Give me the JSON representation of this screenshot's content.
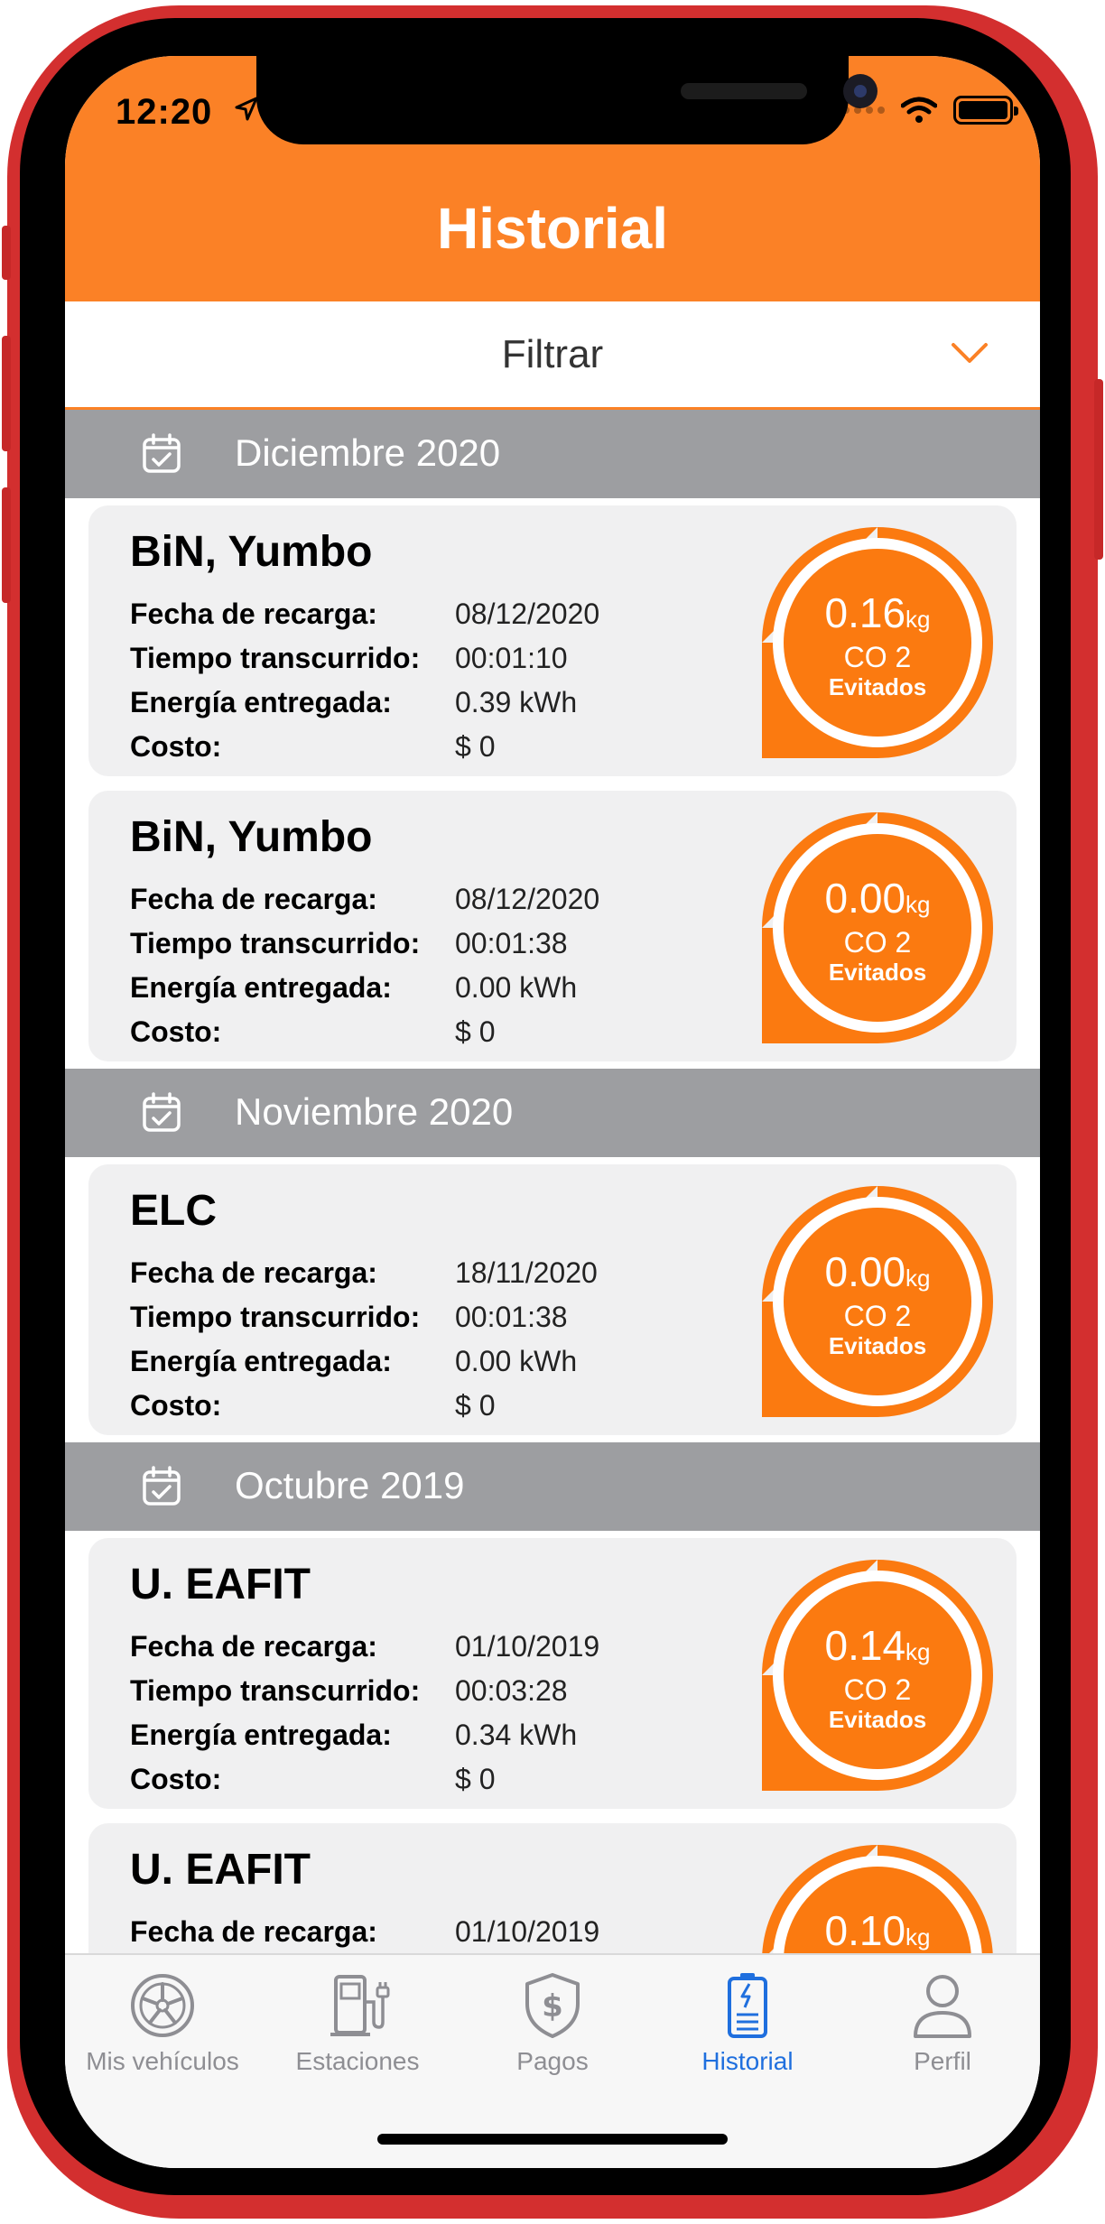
{
  "status_bar": {
    "time": "12:20"
  },
  "header": {
    "title": "Historial"
  },
  "filter": {
    "label": "Filtrar"
  },
  "labels": {
    "fecha": "Fecha de recarga:",
    "tiempo": "Tiempo transcurrido:",
    "energia": "Energía entregada:",
    "costo": "Costo:",
    "kg": "kg",
    "co2": "CO 2",
    "evitados": "Evitados"
  },
  "sections": [
    {
      "label": "Diciembre 2020"
    },
    {
      "label": "Noviembre 2020"
    },
    {
      "label": "Octubre 2019"
    }
  ],
  "cards": [
    {
      "station": "BiN, Yumbo",
      "date": "08/12/2020",
      "elapsed": "00:01:10",
      "energy": "0.39 kWh",
      "cost": "$ 0",
      "co2": "0.16"
    },
    {
      "station": "BiN, Yumbo",
      "date": "08/12/2020",
      "elapsed": "00:01:38",
      "energy": "0.00 kWh",
      "cost": "$ 0",
      "co2": "0.00"
    },
    {
      "station": "ELC",
      "date": "18/11/2020",
      "elapsed": "00:01:38",
      "energy": "0.00 kWh",
      "cost": "$ 0",
      "co2": "0.00"
    },
    {
      "station": "U. EAFIT",
      "date": "01/10/2019",
      "elapsed": "00:03:28",
      "energy": "0.34 kWh",
      "cost": "$ 0",
      "co2": "0.14"
    },
    {
      "station": "U. EAFIT",
      "date": "01/10/2019",
      "elapsed": "",
      "energy": "",
      "cost": "",
      "co2": "0.10"
    }
  ],
  "tabs": [
    {
      "label": "Mis vehículos",
      "icon": "wheel-icon"
    },
    {
      "label": "Estaciones",
      "icon": "charging-station-icon"
    },
    {
      "label": "Pagos",
      "icon": "shield-dollar-icon"
    },
    {
      "label": "Historial",
      "icon": "battery-history-icon",
      "active": true
    },
    {
      "label": "Perfil",
      "icon": "person-icon"
    }
  ],
  "colors": {
    "brand_orange": "#fb8126",
    "section_gray": "#9d9ea1",
    "active_tab": "#1f6fde",
    "inactive_tab": "#8e8e93"
  }
}
